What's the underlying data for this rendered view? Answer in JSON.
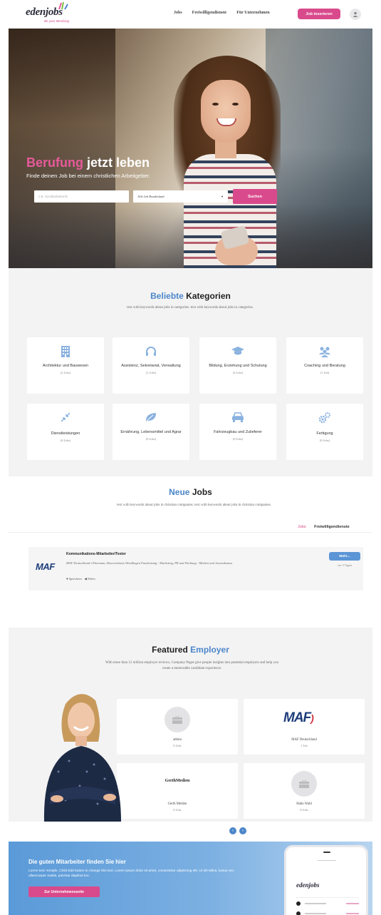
{
  "header": {
    "logo_text": "edenjobs",
    "logo_sub": "Be your Berufung",
    "nav": [
      "Jobs",
      "Freiwilligendienste",
      "Für Unternehmen"
    ],
    "cta": "Job inserieren",
    "user_icon": "user-icon"
  },
  "hero": {
    "title_accent": "Berufung",
    "title_rest": "jetzt leben",
    "subtitle": "Finde deinen Job bei einem christlichen Arbeitgeber.",
    "search_placeholder": "z.B. Sozialarbeiter/in",
    "select_value": "Alle Job Bundesland",
    "search_button": "Suchen"
  },
  "categories": {
    "title_accent": "Beliebte",
    "title_rest": "Kategorien",
    "description": "text with keywords about jobs in categories. text with keywords about jobs in categories.",
    "items": [
      {
        "name": "Architektur und Bauwesen",
        "count": "(2 Jobs)",
        "icon": "building-icon"
      },
      {
        "name": "Assistenz, Sekretariat, Verwaltung",
        "count": "(1 Jobs)",
        "icon": "headset-icon"
      },
      {
        "name": "Bildung, Erziehung und Schulung",
        "count": "(4 Jobs)",
        "icon": "graduation-cap-icon"
      },
      {
        "name": "Coaching und Beratung",
        "count": "(1 Job)",
        "icon": "team-icon"
      },
      {
        "name": "Dienstleistungen",
        "count": "(0 Jobs)",
        "icon": "arrows-icon"
      },
      {
        "name": "Ernährung, Lebensmittel und Agrar",
        "count": "(0 Jobs)",
        "icon": "leaf-icon"
      },
      {
        "name": "Fahrzeugbau und Zulieferer",
        "count": "(0 Jobs)",
        "icon": "car-icon"
      },
      {
        "name": "Fertigung",
        "count": "(0 Jobs)",
        "icon": "gears-icon"
      }
    ]
  },
  "jobs": {
    "title_accent": "Neue",
    "title_rest": "Jobs",
    "description": "text with keywords about jobs in christian companies. text with keywords about jobs in christian companies.",
    "tabs": [
      "Jobs",
      "Freiwilligendienste"
    ],
    "listing": {
      "logo": "MAF",
      "title": "Kommunikations-Mitarbeiter/Texter",
      "meta": "MAF Deutschland  ▪ Ehrenamt, Honorarbasis  Wendlingen  Fundraising - Marketing, PR und Werbung - Medien und Journalismus",
      "save": "♥ Speichern",
      "share": "◀ Teilen",
      "more": "Mehr...",
      "age": "vor 5 Tagen"
    }
  },
  "featured": {
    "title_rest": "Featured",
    "title_accent": "Employer",
    "description": "With more than 12 million employer reviews, Company Pages give people insights into potential employers and help you create a memorable candidate experience.",
    "employers": [
      {
        "name": "admin",
        "jobs": "0 Jobs",
        "logo": "briefcase-icon"
      },
      {
        "name": "MAF Deutschland",
        "jobs": "1 Job",
        "logo": "MAF"
      },
      {
        "name": "Gerth Medien",
        "jobs": "0 Jobs",
        "logo": "GerthMedien"
      },
      {
        "name": "Hahn Wald",
        "jobs": "0 Jobs",
        "logo": "briefcase-icon"
      }
    ]
  },
  "banner": {
    "title": "Die guten Mitarbeiter finden Sie hier",
    "text": "Lorem text: Knöpfe, Child Edit button to change this text. Lorem ipsum dolor sit amet, consectetur adipiscing elit. Ut elit tellus, luctus nec ullamcorper mattis, pulvinar dapibus leo.",
    "button": "Zur Unternehmensseite",
    "mockup_logo": "edenjobs"
  },
  "colors": {
    "pink": "#d94a8c",
    "blue": "#4c86c9",
    "section_gray": "#f3f3f4"
  }
}
